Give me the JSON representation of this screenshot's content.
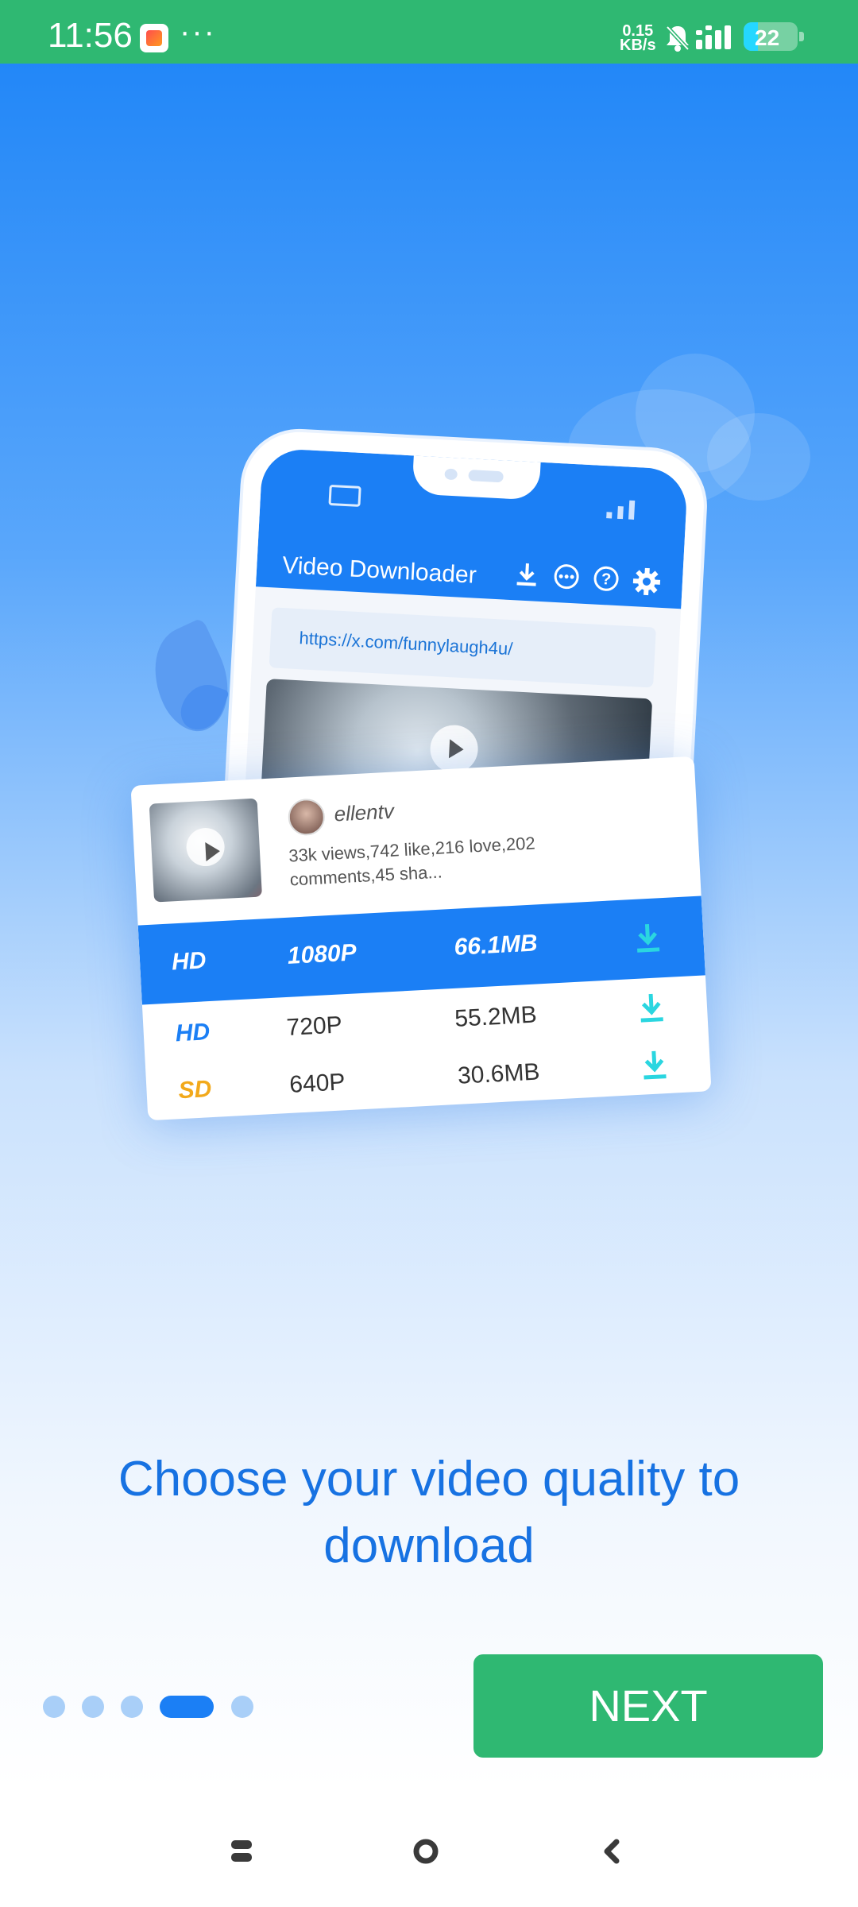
{
  "status_bar": {
    "time": "11:56",
    "overflow": "···",
    "speed_value": "0.15",
    "speed_unit": "KB/s",
    "battery": "22"
  },
  "illustration": {
    "app_title": "Video Downloader",
    "url": "https://x.com/funnylaugh4u/",
    "card": {
      "username": "ellentv",
      "stats": "33k views,742 like,216 love,202 comments,45 sha..."
    },
    "qualities": [
      {
        "tag": "HD",
        "resolution": "1080P",
        "size": "66.1MB",
        "selected": true
      },
      {
        "tag": "HD",
        "resolution": "720P",
        "size": "55.2MB",
        "selected": false
      },
      {
        "tag": "SD",
        "resolution": "640P",
        "size": "30.6MB",
        "selected": false
      }
    ]
  },
  "caption": "Choose your video quality to download",
  "pager": {
    "total": 5,
    "active_index": 4
  },
  "next_button": "NEXT",
  "colors": {
    "status_green": "#2fb872",
    "brand_blue": "#1b7ff5",
    "sd_orange": "#f2a91b",
    "dl_cyan": "#2ad6e0"
  },
  "icons": [
    "download-icon",
    "chat-icon",
    "help-icon",
    "settings-icon",
    "play-icon",
    "nav-recents-icon",
    "nav-home-icon",
    "nav-back-icon"
  ]
}
